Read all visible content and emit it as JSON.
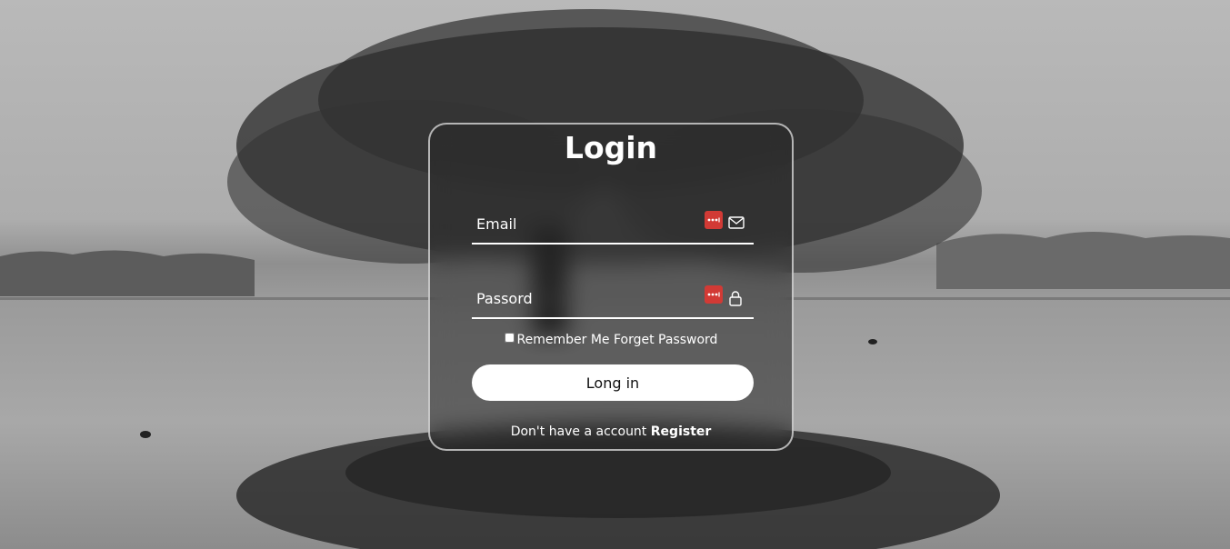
{
  "login": {
    "title": "Login",
    "email": {
      "placeholder": "Email",
      "icon": "mail-icon"
    },
    "password": {
      "placeholder": "Passord",
      "icon": "lock-icon"
    },
    "remember_label": "Remember Me",
    "forgot_label": "Forget Password",
    "submit_label": "Long in",
    "register_prompt": "Don't have a account",
    "register_link": "Register"
  },
  "colors": {
    "card_border": "#ffffff",
    "button_bg": "#ffffff",
    "password_manager_badge": "#d23a35"
  }
}
